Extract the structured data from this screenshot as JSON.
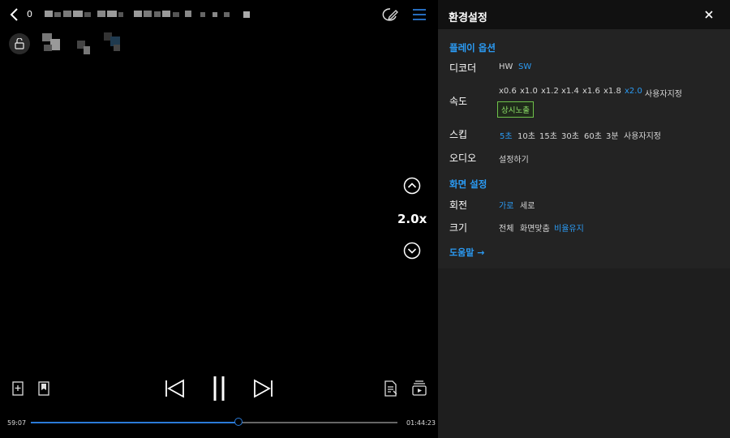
{
  "player": {
    "title_prefix": "0",
    "speed": "2.0x",
    "speed_fraction": 0.5,
    "time_elapsed": "59:07",
    "time_total": "01:44:23",
    "progress": 0.566
  },
  "settings": {
    "title": "환경설정",
    "play_options": {
      "section": "플레이 옵션",
      "decoder": {
        "label": "디코더",
        "options": [
          "HW",
          "SW"
        ],
        "selected": "SW"
      },
      "speed": {
        "label": "속도",
        "options": [
          "x0.6",
          "x1.0",
          "x1.2",
          "x1.4",
          "x1.6",
          "x1.8",
          "x2.0",
          "사용자지정"
        ],
        "selected": "x2.0",
        "badge": "상시노출"
      },
      "skip": {
        "label": "스킵",
        "options": [
          "5초",
          "10초",
          "15초",
          "30초",
          "60초",
          "3분",
          "사용자지정"
        ],
        "selected": "5초"
      },
      "audio": {
        "label": "오디오",
        "value": "설정하기"
      }
    },
    "screen": {
      "section": "화면 설정",
      "rotation": {
        "label": "회전",
        "options": [
          "가로",
          "세로"
        ],
        "selected": "가로"
      },
      "size": {
        "label": "크기",
        "options": [
          "전체",
          "화면맞춤",
          "비율유지"
        ],
        "selected": "비율유지"
      }
    },
    "help": "도움말 →"
  },
  "colors": {
    "accent": "#2b9bf4",
    "badge": "#8fe36a"
  },
  "icons": [
    "back-icon",
    "lock-icon",
    "edit-icon",
    "menu-icon",
    "close-icon",
    "chevron-up-icon",
    "chevron-down-icon",
    "bookmark-add-icon",
    "bookmark-icon",
    "rewind-icon",
    "pause-icon",
    "forward-icon",
    "document-icon",
    "playlist-icon"
  ]
}
